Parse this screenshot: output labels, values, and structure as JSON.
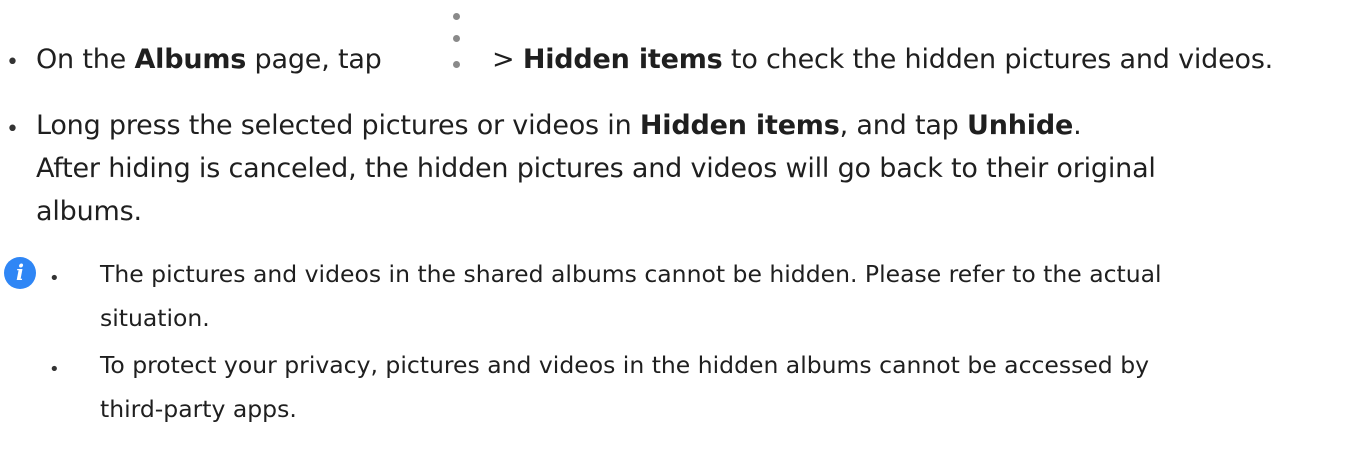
{
  "items": [
    {
      "bullet": "•",
      "prefix": "On the ",
      "albums": "Albums",
      "mid": " page, tap",
      "arrow": ">",
      "hidden": "Hidden items",
      "suffix": " to check the hidden pictures and videos."
    },
    {
      "bullet": "•",
      "prefix": "Long press the selected pictures or videos in ",
      "hidden": "Hidden items",
      "mid": ", and tap ",
      "unhide": "Unhide",
      "end": ".",
      "line2": "After hiding is canceled, the hidden pictures and videos will go back to their original",
      "line3": "albums."
    }
  ],
  "icons": {
    "menu": "more-vertical-icon",
    "note": "info-icon"
  },
  "note": {
    "icon_glyph": "i",
    "icon_color": "#2f86f5",
    "bullets": [
      {
        "bullet": "•",
        "line1": "The pictures and videos in the shared albums cannot be hidden. Please refer to the actual",
        "line2": "situation."
      },
      {
        "bullet": "•",
        "line1": "To protect your privacy, pictures and videos in the hidden albums cannot be accessed by",
        "line2": "third-party apps."
      }
    ]
  }
}
